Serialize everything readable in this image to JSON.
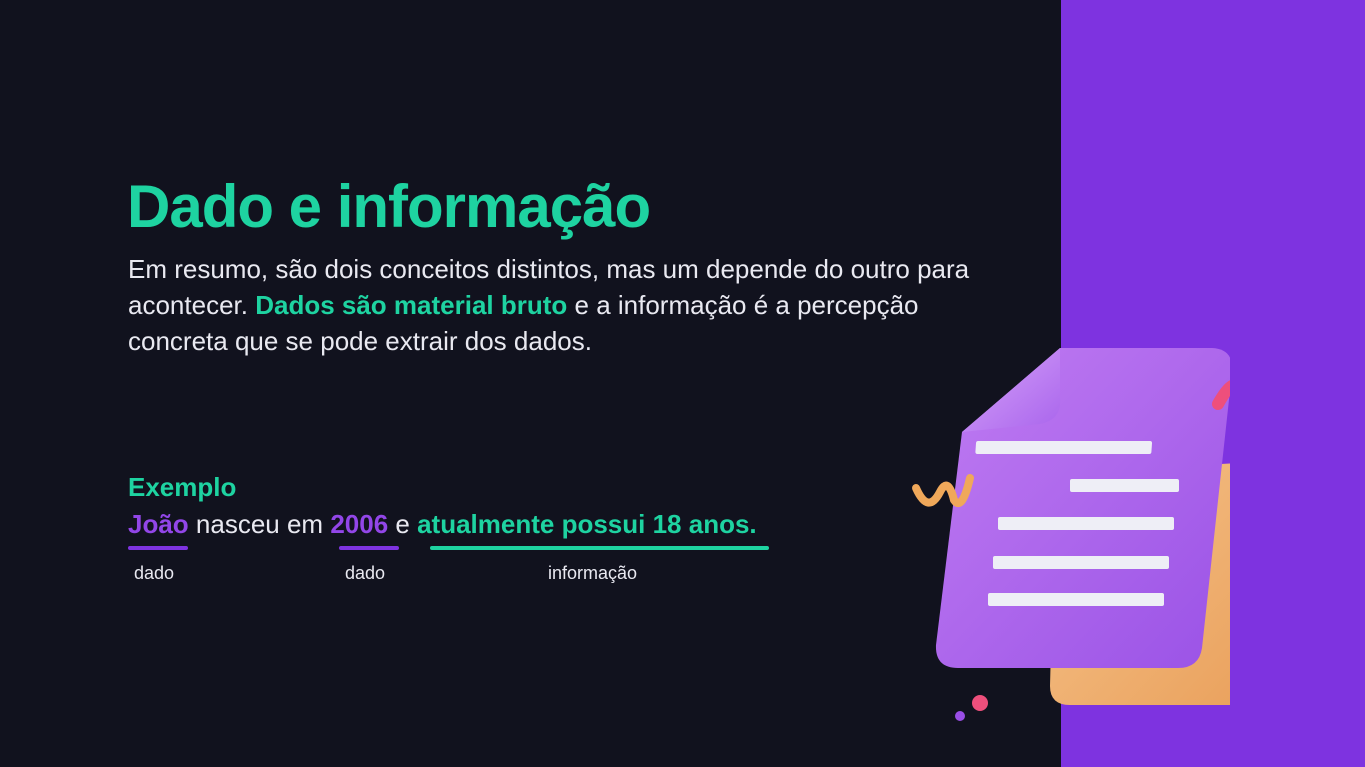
{
  "slide": {
    "title": "Dado e informação",
    "paragraph": {
      "before": "Em resumo, são dois conceitos distintos, mas um depende do outro para acontecer. ",
      "highlight": "Dados são material bruto",
      "after": " e a informação é a percepção concreta que se pode extrair dos dados."
    },
    "example": {
      "label": "Exemplo",
      "word_1": "João",
      "text_1": " nasceu em ",
      "word_2": "2006",
      "text_2": " e ",
      "phrase_3": "atualmente possui 18 anos.",
      "caption_1": "dado",
      "caption_2": "dado",
      "caption_3": "informação"
    }
  },
  "illustration": {
    "icon": "document-3d-icon"
  },
  "colors": {
    "background": "#11121e",
    "accent_green": "#1ed3a1",
    "accent_purple": "#7e33e0",
    "text": "#e9e9f1",
    "paper_orange": "#f0b070",
    "ribbon_pink": "#ee4f7c"
  }
}
